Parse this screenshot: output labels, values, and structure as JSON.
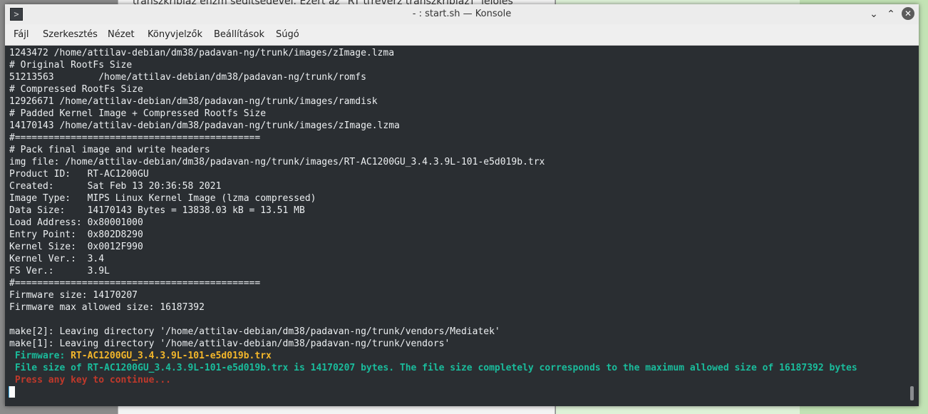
{
  "background": {
    "doc_text": "transzkripiaz ehzm segitsegevel. Ezert az \"RT t[reverz transzkripiaz]\" jelolés"
  },
  "window": {
    "title": "- : start.sh — Konsole",
    "icon": "terminal-icon",
    "controls": {
      "minimize": "⌄",
      "maximize": "⌃",
      "close": "✕"
    }
  },
  "menu": {
    "items": [
      "Fájl",
      "Szerkesztés",
      "Nézet",
      "Könyvjelzők",
      "Beállítások",
      "Súgó"
    ]
  },
  "colors": {
    "terminal_bg": "#2a2e32",
    "text": "#eceff1",
    "cyan": "#1abc9c",
    "yellow": "#f3b62a",
    "red": "#c0392b"
  },
  "terminal": {
    "lines": [
      [
        {
          "t": "1243472 /home/attilav-debian/dm38/padavan-ng/trunk/images/zImage.lzma"
        }
      ],
      [
        {
          "t": "# Original RootFs Size"
        }
      ],
      [
        {
          "t": "51213563        /home/attilav-debian/dm38/padavan-ng/trunk/romfs"
        }
      ],
      [
        {
          "t": "# Compressed RootFs Size"
        }
      ],
      [
        {
          "t": "12926671 /home/attilav-debian/dm38/padavan-ng/trunk/images/ramdisk"
        }
      ],
      [
        {
          "t": "# Padded Kernel Image + Compressed Rootfs Size"
        }
      ],
      [
        {
          "t": "14170143 /home/attilav-debian/dm38/padavan-ng/trunk/images/zImage.lzma"
        }
      ],
      [
        {
          "t": "#============================================"
        }
      ],
      [
        {
          "t": "# Pack final image and write headers"
        }
      ],
      [
        {
          "t": "img file: /home/attilav-debian/dm38/padavan-ng/trunk/images/RT-AC1200GU_3.4.3.9L-101-e5d019b.trx"
        }
      ],
      [
        {
          "t": "Product ID:   RT-AC1200GU"
        }
      ],
      [
        {
          "t": "Created:      Sat Feb 13 20:36:58 2021"
        }
      ],
      [
        {
          "t": "Image Type:   MIPS Linux Kernel Image (lzma compressed)"
        }
      ],
      [
        {
          "t": "Data Size:    14170143 Bytes = 13838.03 kB = 13.51 MB"
        }
      ],
      [
        {
          "t": "Load Address: 0x80001000"
        }
      ],
      [
        {
          "t": "Entry Point:  0x802D8290"
        }
      ],
      [
        {
          "t": "Kernel Size:  0x0012F990"
        }
      ],
      [
        {
          "t": "Kernel Ver.:  3.4"
        }
      ],
      [
        {
          "t": "FS Ver.:      3.9L"
        }
      ],
      [
        {
          "t": "#============================================"
        }
      ],
      [
        {
          "t": "Firmware size: 14170207"
        }
      ],
      [
        {
          "t": "Firmware max allowed size: 16187392"
        }
      ],
      [
        {
          "t": ""
        }
      ],
      [
        {
          "t": "make[2]: Leaving directory '/home/attilav-debian/dm38/padavan-ng/trunk/vendors/Mediatek'"
        }
      ],
      [
        {
          "t": "make[1]: Leaving directory '/home/attilav-debian/dm38/padavan-ng/trunk/vendors'"
        }
      ],
      [
        {
          "t": " Firmware: ",
          "c": "cyan"
        },
        {
          "t": "RT-AC1200GU_3.4.3.9L-101-e5d019b.trx",
          "c": "yellow"
        }
      ],
      [
        {
          "t": " File size of RT-AC1200GU_3.4.3.9L-101-e5d019b.trx is 14170207 bytes. The file size completely corresponds to the maximum allowed size of 16187392 bytes",
          "c": "cyan"
        }
      ],
      [
        {
          "t": " Press any key to continue...",
          "c": "red"
        }
      ]
    ]
  }
}
